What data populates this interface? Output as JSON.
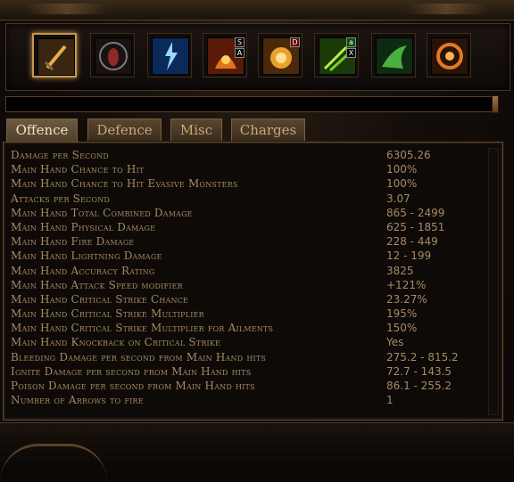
{
  "skills": [
    {
      "name": "sword-icon",
      "color": "#c9902c",
      "selected": true,
      "badges": []
    },
    {
      "name": "red-spirit-icon",
      "color": "#6a2a2a",
      "selected": false,
      "badges": []
    },
    {
      "name": "lightning-figure-icon",
      "color": "#2f7fd8",
      "selected": false,
      "badges": []
    },
    {
      "name": "fire-figure-icon",
      "color": "#c8541c",
      "selected": false,
      "badges": [
        "S",
        "A"
      ]
    },
    {
      "name": "fire-burst-icon",
      "color": "#d48a1e",
      "selected": false,
      "badges": [
        "D"
      ]
    },
    {
      "name": "green-arrows-icon",
      "color": "#5aa81e",
      "selected": false,
      "badges": [
        "a",
        "X"
      ]
    },
    {
      "name": "green-figure-icon",
      "color": "#3a8a3a",
      "selected": false,
      "badges": []
    },
    {
      "name": "orange-ring-icon",
      "color": "#d86a1a",
      "selected": false,
      "badges": []
    }
  ],
  "progress": {
    "fraction": 0.0
  },
  "tabs": [
    {
      "label": "Offence",
      "active": true
    },
    {
      "label": "Defence",
      "active": false
    },
    {
      "label": "Misc",
      "active": false
    },
    {
      "label": "Charges",
      "active": false
    }
  ],
  "stats": [
    {
      "label": "Damage per Second",
      "value": "6305.26"
    },
    {
      "label": "Main Hand Chance to Hit",
      "value": "100%"
    },
    {
      "label": "Main Hand Chance to Hit Evasive Monsters",
      "value": "100%"
    },
    {
      "label": "Attacks per Second",
      "value": "3.07"
    },
    {
      "label": "Main Hand Total Combined Damage",
      "value": "865 - 2499"
    },
    {
      "label": "Main Hand Physical Damage",
      "value": "625 - 1851"
    },
    {
      "label": "Main Hand Fire Damage",
      "value": "228 - 449"
    },
    {
      "label": "Main Hand Lightning Damage",
      "value": "12 - 199"
    },
    {
      "label": "Main Hand Accuracy Rating",
      "value": "3825"
    },
    {
      "label": "Main Hand Attack Speed modifier",
      "value": "+121%"
    },
    {
      "label": "Main Hand Critical Strike Chance",
      "value": "23.27%"
    },
    {
      "label": "Main Hand Critical Strike Multiplier",
      "value": "195%"
    },
    {
      "label": "Main Hand Critical Strike Multiplier for Ailments",
      "value": "150%"
    },
    {
      "label": "Main Hand Knockback on Critical Strike",
      "value": "Yes"
    },
    {
      "label": "Bleeding Damage per second from Main Hand hits",
      "value": "275.2 - 815.2"
    },
    {
      "label": "Ignite Damage per second from Main Hand hits",
      "value": "72.7 - 143.5"
    },
    {
      "label": "Poison Damage per second from Main Hand hits",
      "value": "86.1 - 255.2"
    },
    {
      "label": "Number of Arrows to fire",
      "value": "1"
    }
  ],
  "colors": {
    "text": "#a88a62",
    "accent": "#c8964a",
    "tab_active_text": "#f2e2c4"
  }
}
